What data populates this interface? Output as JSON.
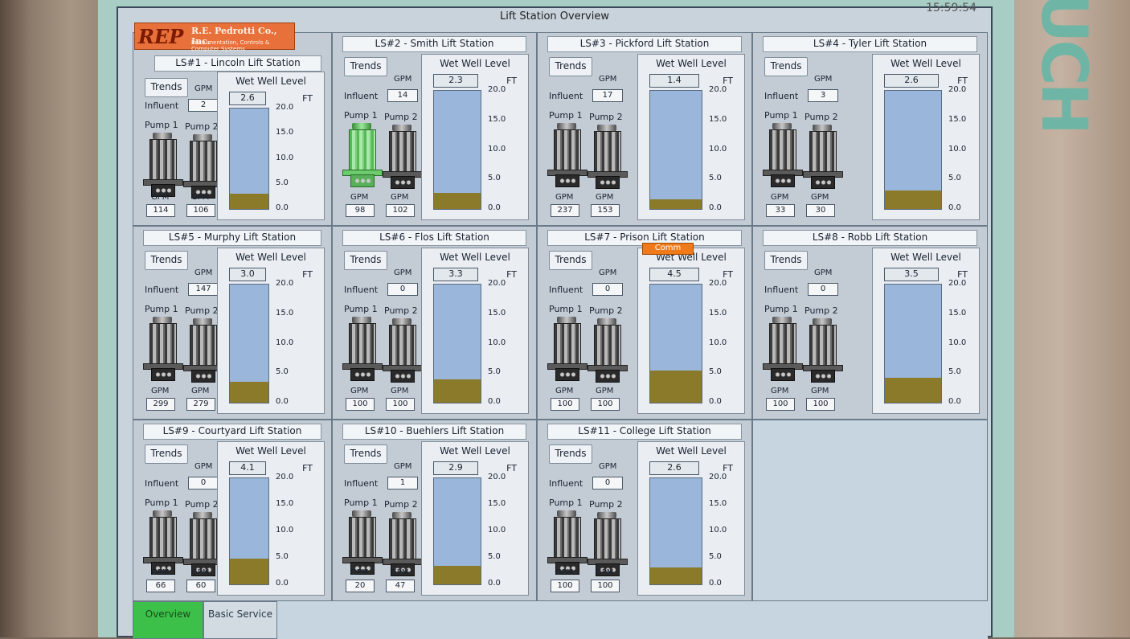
{
  "screen": {
    "title": "Lift Station Overview",
    "clock": "15:59:54"
  },
  "logo": {
    "main": "REP",
    "company": "R.E. Pedrotti Co., Inc.",
    "tagline": "Instrumentation, Controls & Computer Systems"
  },
  "brand": "UCH",
  "labels": {
    "trends": "Trends",
    "gpm": "GPM",
    "influent": "Influent",
    "pump1": "Pump 1",
    "pump2": "Pump 2",
    "wet_well": "Wet Well Level",
    "ft": "FT",
    "comm": "Comm"
  },
  "scale_ticks": [
    "20.0",
    "15.0",
    "10.0",
    "5.0",
    "0.0"
  ],
  "stations": [
    {
      "title": "LS#1 - Lincoln Lift Station",
      "influent": "2",
      "level": "2.6",
      "level_value": 2.6,
      "pump1_gpm": "114",
      "pump2_gpm": "106",
      "pump1_running": false
    },
    {
      "title": "LS#2 - Smith Lift Station",
      "influent": "14",
      "level": "2.3",
      "level_value": 2.3,
      "pump1_gpm": "98",
      "pump2_gpm": "102",
      "pump1_running": true
    },
    {
      "title": "LS#3 - Pickford Lift Station",
      "influent": "17",
      "level": "1.4",
      "level_value": 1.4,
      "pump1_gpm": "237",
      "pump2_gpm": "153",
      "pump1_running": false
    },
    {
      "title": "LS#4 - Tyler Lift Station",
      "influent": "3",
      "level": "2.6",
      "level_value": 2.6,
      "pump1_gpm": "33",
      "pump2_gpm": "30",
      "pump1_running": false
    },
    {
      "title": "LS#5 - Murphy Lift Station",
      "influent": "147",
      "level": "3.0",
      "level_value": 3.0,
      "pump1_gpm": "299",
      "pump2_gpm": "279",
      "pump1_running": false
    },
    {
      "title": "LS#6 - Flos Lift Station",
      "influent": "0",
      "level": "3.3",
      "level_value": 3.3,
      "pump1_gpm": "100",
      "pump2_gpm": "100",
      "pump1_running": false
    },
    {
      "title": "LS#7 - Prison Lift Station",
      "influent": "0",
      "level": "4.5",
      "level_value": 4.5,
      "pump1_gpm": "100",
      "pump2_gpm": "100",
      "pump1_running": false,
      "comm_alarm": true
    },
    {
      "title": "LS#8 - Robb Lift Station",
      "influent": "0",
      "level": "3.5",
      "level_value": 3.5,
      "pump1_gpm": "100",
      "pump2_gpm": "100",
      "pump1_running": false
    },
    {
      "title": "LS#9 - Courtyard Lift Station",
      "influent": "0",
      "level": "4.1",
      "level_value": 4.1,
      "pump1_gpm": "66",
      "pump2_gpm": "60",
      "pump1_running": false
    },
    {
      "title": "LS#10 - Buehlers Lift Station",
      "influent": "1",
      "level": "2.9",
      "level_value": 2.9,
      "pump1_gpm": "20",
      "pump2_gpm": "47",
      "pump1_running": false
    },
    {
      "title": "LS#11 - College Lift Station",
      "influent": "0",
      "level": "2.6",
      "level_value": 2.6,
      "pump1_gpm": "100",
      "pump2_gpm": "100",
      "pump1_running": false
    }
  ],
  "tabs": [
    {
      "label": "Overview",
      "active": true
    },
    {
      "label": "Basic Service",
      "active": false
    }
  ],
  "colors": {
    "frame": "#a7cdc5",
    "tank_water": "#9ab6da",
    "tank_sludge": "#8a7a2a",
    "pump_running": "#5ab85a",
    "comm_alarm": "#f07a1a",
    "active_tab": "#3cc04a"
  }
}
